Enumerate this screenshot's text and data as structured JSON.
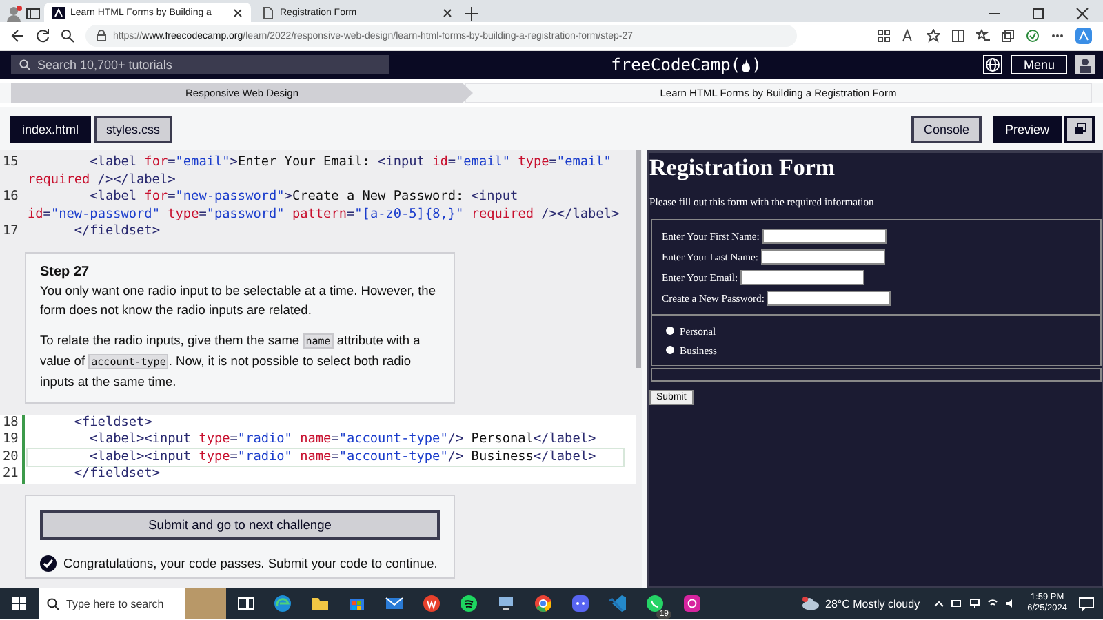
{
  "browser": {
    "tabs": [
      {
        "title": "Learn HTML Forms by Building a",
        "selected": true,
        "kind": "site"
      },
      {
        "title": "Registration Form",
        "selected": false,
        "kind": "page"
      }
    ],
    "url": "https://**www.freecodecamp.org**/learn/2022/responsive-web-design/learn-html-forms-by-building-a-registration-form/step-27"
  },
  "site_header": {
    "search_placeholder": "Search 10,700+ tutorials",
    "logo_text": "freeCodeCamp(",
    "logo_close": ")",
    "menu_button": "Menu"
  },
  "breadcrumb": [
    {
      "label": "Responsive Web Design",
      "selected": false
    },
    {
      "label": "Learn HTML Forms by Building a Registration Form",
      "selected": true
    }
  ],
  "file_tabs": [
    {
      "label": "index.html",
      "selected": true
    },
    {
      "label": "styles.css",
      "selected": false
    }
  ],
  "view_buttons": [
    {
      "label": "Console",
      "selected": false
    },
    {
      "label": "Preview",
      "selected": true
    }
  ],
  "code_top": [
    {
      "number": "15",
      "tokens": [
        {
          "kind": "tag",
          "text": "        <label "
        },
        {
          "kind": "attr",
          "text": "for"
        },
        {
          "kind": "tag",
          "text": "="
        },
        {
          "kind": "string",
          "text": "\"email\""
        },
        {
          "kind": "tag",
          "text": ">"
        },
        {
          "kind": "text",
          "text": "Enter Your Email: "
        },
        {
          "kind": "tag",
          "text": "<input "
        },
        {
          "kind": "attr",
          "text": "id"
        },
        {
          "kind": "tag",
          "text": "="
        },
        {
          "kind": "string",
          "text": "\"email\" "
        },
        {
          "kind": "attr",
          "text": "type"
        },
        {
          "kind": "tag",
          "text": "="
        },
        {
          "kind": "string",
          "text": "\"email\" "
        },
        {
          "kind": "attr",
          "text": "required"
        },
        {
          "kind": "tag",
          "text": " /></label>"
        }
      ]
    },
    {
      "number": "16",
      "tokens": [
        {
          "kind": "tag",
          "text": "        <label "
        },
        {
          "kind": "attr",
          "text": "for"
        },
        {
          "kind": "tag",
          "text": "="
        },
        {
          "kind": "string",
          "text": "\"new-password\""
        },
        {
          "kind": "tag",
          "text": ">"
        },
        {
          "kind": "text",
          "text": "Create a New Password: "
        },
        {
          "kind": "tag",
          "text": "<input "
        },
        {
          "kind": "attr",
          "text": "id"
        },
        {
          "kind": "tag",
          "text": "="
        },
        {
          "kind": "string",
          "text": "\"new-password\" "
        },
        {
          "kind": "attr",
          "text": "type"
        },
        {
          "kind": "tag",
          "text": "="
        },
        {
          "kind": "string",
          "text": "\"password\" "
        },
        {
          "kind": "attr",
          "text": "pattern"
        },
        {
          "kind": "tag",
          "text": "="
        },
        {
          "kind": "string",
          "text": "\"[a-z0-5]{8,}\" "
        },
        {
          "kind": "attr",
          "text": "required"
        },
        {
          "kind": "tag",
          "text": " /></label>"
        }
      ]
    },
    {
      "number": "17",
      "tokens": [
        {
          "kind": "tag",
          "text": "      </fieldset>"
        }
      ]
    }
  ],
  "step": {
    "title": "Step 27",
    "paragraphs": [
      [
        {
          "kind": "text",
          "text": "You only want one radio input to be selectable at a time. However, the form does not know the radio inputs are related."
        }
      ],
      [
        {
          "kind": "text",
          "text": "To relate the radio inputs, give them the same "
        },
        {
          "kind": "code",
          "text": "name"
        },
        {
          "kind": "text",
          "text": " attribute with a value of "
        },
        {
          "kind": "code",
          "text": "account-type"
        },
        {
          "kind": "text",
          "text": ". Now, it is not possible to select both radio inputs at the same time."
        }
      ]
    ]
  },
  "code_editable": [
    {
      "number": "18",
      "active": false,
      "tokens": [
        {
          "kind": "tag",
          "text": "      <fieldset>"
        }
      ]
    },
    {
      "number": "19",
      "active": false,
      "tokens": [
        {
          "kind": "tag",
          "text": "        <label><input "
        },
        {
          "kind": "attr",
          "text": "type"
        },
        {
          "kind": "tag",
          "text": "="
        },
        {
          "kind": "string",
          "text": "\"radio\" "
        },
        {
          "kind": "attr",
          "text": "name"
        },
        {
          "kind": "tag",
          "text": "="
        },
        {
          "kind": "string",
          "text": "\"account-type\""
        },
        {
          "kind": "tag",
          "text": "/>"
        },
        {
          "kind": "text",
          "text": " Personal"
        },
        {
          "kind": "tag",
          "text": "</label>"
        }
      ]
    },
    {
      "number": "20",
      "active": true,
      "tokens": [
        {
          "kind": "tag",
          "text": "        <label><input "
        },
        {
          "kind": "attr",
          "text": "type"
        },
        {
          "kind": "tag",
          "text": "="
        },
        {
          "kind": "string",
          "text": "\"radio\" "
        },
        {
          "kind": "attr",
          "text": "name"
        },
        {
          "kind": "tag",
          "text": "="
        },
        {
          "kind": "string",
          "text": "\"account-type\""
        },
        {
          "kind": "tag",
          "text": "/>"
        },
        {
          "kind": "text",
          "text": " Business"
        },
        {
          "kind": "tag",
          "text": "</label>"
        }
      ]
    },
    {
      "number": "21",
      "active": false,
      "tokens": [
        {
          "kind": "tag",
          "text": "      </fieldset>"
        }
      ]
    }
  ],
  "submit_button": "Submit and go to next challenge",
  "result_message": "Congratulations, your code passes. Submit your code to continue.",
  "preview": {
    "heading": "Registration Form",
    "intro": "Please fill out this form with the required information",
    "fields": [
      {
        "label": "Enter Your First Name:"
      },
      {
        "label": "Enter Your Last Name:"
      },
      {
        "label": "Enter Your Email:"
      },
      {
        "label": "Create a New Password:"
      }
    ],
    "radios": [
      {
        "label": "Personal",
        "checked": false
      },
      {
        "label": "Business",
        "checked": false
      }
    ],
    "submit": "Submit"
  },
  "taskbar": {
    "search_placeholder": "Type here to search",
    "apps": [
      {
        "kind": "taskview"
      },
      {
        "kind": "edge"
      },
      {
        "kind": "folder"
      },
      {
        "kind": "store"
      },
      {
        "kind": "mail"
      },
      {
        "kind": "office"
      },
      {
        "kind": "music"
      },
      {
        "kind": "computer"
      },
      {
        "kind": "chrome"
      },
      {
        "kind": "chat"
      },
      {
        "kind": "code"
      },
      {
        "kind": "phone",
        "badge": "19"
      },
      {
        "kind": "camera"
      }
    ],
    "weather": "28°C  Mostly cloudy",
    "time": "1:59 PM",
    "date": "6/25/2024"
  }
}
